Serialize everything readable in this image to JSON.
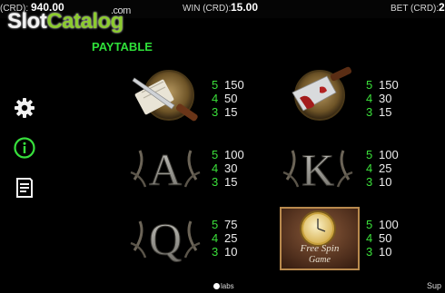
{
  "topbar": {
    "credit_label": "(CRD):",
    "credit_value": "940.00",
    "win_label": "WIN (CRD):",
    "win_value": "15.00",
    "bet_label": "BET (CRD):",
    "bet_value": "2"
  },
  "watermark": {
    "part1": "Slot",
    "part2": "Catalog",
    "suffix": ".com"
  },
  "paytable": {
    "title": "PAYTABLE",
    "symbols": [
      {
        "name": "knife-and-letter",
        "pays": [
          [
            "5",
            "150"
          ],
          [
            "4",
            "50"
          ],
          [
            "3",
            "15"
          ]
        ]
      },
      {
        "name": "bloody-cleaver",
        "pays": [
          [
            "5",
            "150"
          ],
          [
            "4",
            "30"
          ],
          [
            "3",
            "15"
          ]
        ]
      },
      {
        "name": "letter-a",
        "glyph": "A",
        "pays": [
          [
            "5",
            "100"
          ],
          [
            "4",
            "30"
          ],
          [
            "3",
            "15"
          ]
        ]
      },
      {
        "name": "letter-k",
        "glyph": "K",
        "pays": [
          [
            "5",
            "100"
          ],
          [
            "4",
            "25"
          ],
          [
            "3",
            "10"
          ]
        ]
      },
      {
        "name": "letter-q",
        "glyph": "Q",
        "pays": [
          [
            "5",
            "75"
          ],
          [
            "4",
            "25"
          ],
          [
            "3",
            "10"
          ]
        ]
      },
      {
        "name": "free-spin-pocket-watch",
        "caption_1": "Free Spin",
        "caption_2": "Game",
        "pays": [
          [
            "5",
            "100"
          ],
          [
            "4",
            "50"
          ],
          [
            "3",
            "10"
          ]
        ]
      }
    ]
  },
  "side_icons": [
    "gear-icon",
    "info-icon",
    "document-icon"
  ],
  "colors": {
    "pay_count": "#3be03a",
    "title": "#2fe03a",
    "info_icon": "#37e03c"
  },
  "bottombar": {
    "logo_text": "labs",
    "right_text": "Sup"
  }
}
